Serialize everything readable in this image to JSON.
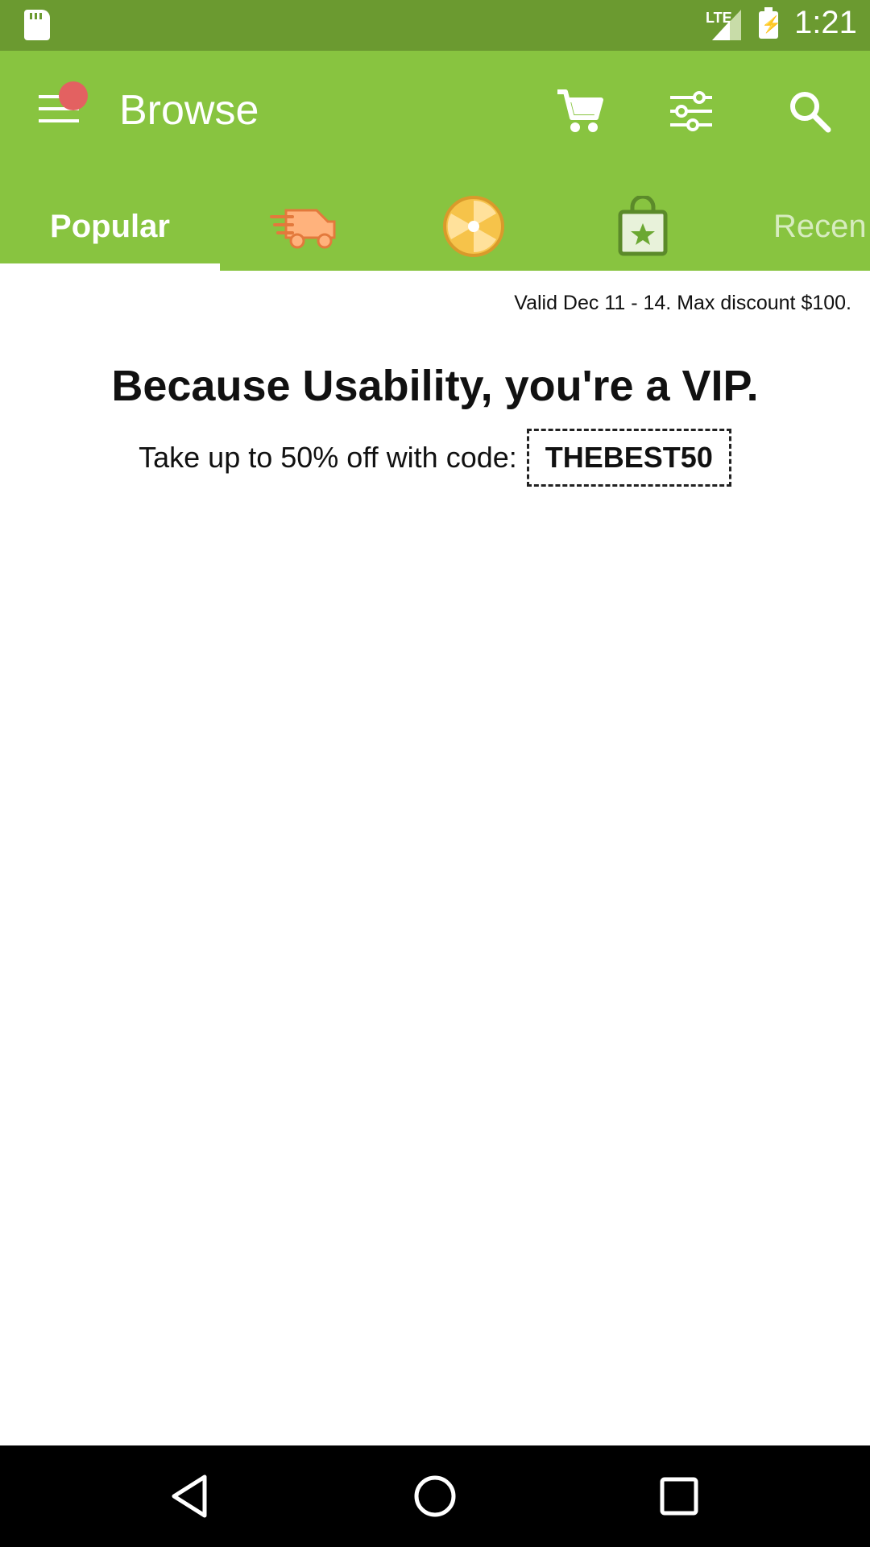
{
  "status_bar": {
    "network_label": "LTE",
    "time": "1:21",
    "icons": [
      "sd-card-icon",
      "signal-icon",
      "battery-charging-icon"
    ]
  },
  "app_bar": {
    "title": "Browse",
    "icons": [
      "menu-icon",
      "cart-icon",
      "filter-icon",
      "search-icon"
    ],
    "has_notification_dot": true
  },
  "tabs": [
    {
      "label": "Popular",
      "selected": true
    },
    {
      "icon": "delivery-truck-icon"
    },
    {
      "icon": "color-wheel-icon"
    },
    {
      "icon": "shopping-bag-star-icon"
    },
    {
      "label": "Recen"
    }
  ],
  "promo": {
    "validity": "Valid Dec 11 - 14. Max discount $100.",
    "title": "Because Usability, you're a VIP.",
    "description": "Take up to 50% off with code:",
    "code": "THEBEST50"
  },
  "nav_bar": {
    "icons": [
      "back-icon",
      "home-icon",
      "recents-icon"
    ]
  },
  "colors": {
    "status_bar": "#6b9a30",
    "app_bar": "#88c440",
    "notification_dot": "#e36161",
    "nav_bar": "#000000"
  }
}
